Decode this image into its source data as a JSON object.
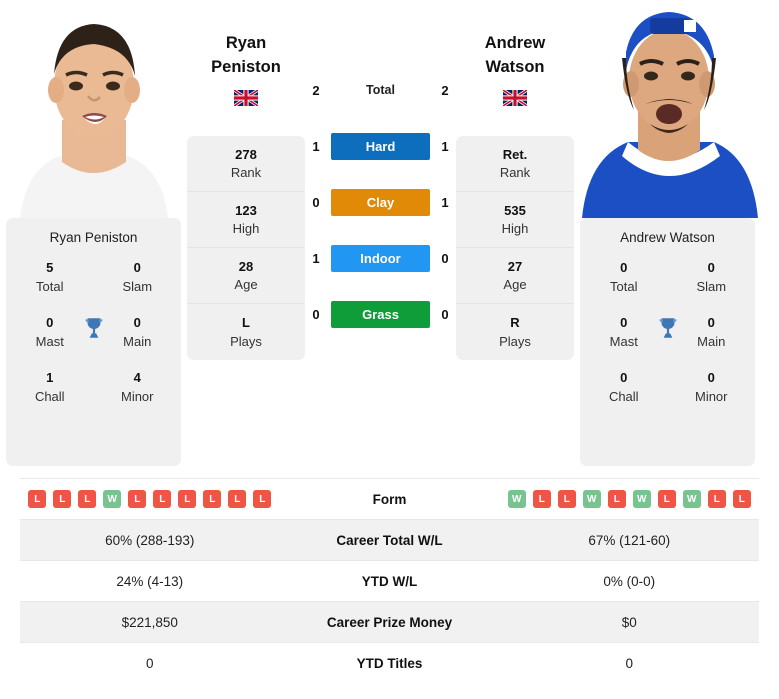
{
  "players": {
    "left": {
      "first_name": "Ryan",
      "last_name": "Peniston",
      "full_name": "Ryan Peniston",
      "flag": "united-kingdom-flag",
      "rank": "278",
      "rank_label": "Rank",
      "high": "123",
      "high_label": "High",
      "age": "28",
      "age_label": "Age",
      "plays": "L",
      "plays_label": "Plays",
      "titles": {
        "total": "5",
        "total_label": "Total",
        "slam": "0",
        "slam_label": "Slam",
        "mast": "0",
        "mast_label": "Mast",
        "main": "0",
        "main_label": "Main",
        "chall": "1",
        "chall_label": "Chall",
        "minor": "4",
        "minor_label": "Minor"
      },
      "form": [
        "L",
        "L",
        "L",
        "W",
        "L",
        "L",
        "L",
        "L",
        "L",
        "L"
      ],
      "career_total_wl": "60% (288-193)",
      "ytd_wl": "24% (4-13)",
      "career_prize_money": "$221,850",
      "ytd_titles": "0"
    },
    "right": {
      "first_name": "Andrew",
      "last_name": "Watson",
      "full_name": "Andrew Watson",
      "flag": "united-kingdom-flag",
      "rank": "Ret.",
      "rank_label": "Rank",
      "high": "535",
      "high_label": "High",
      "age": "27",
      "age_label": "Age",
      "plays": "R",
      "plays_label": "Plays",
      "titles": {
        "total": "0",
        "total_label": "Total",
        "slam": "0",
        "slam_label": "Slam",
        "mast": "0",
        "mast_label": "Mast",
        "main": "0",
        "main_label": "Main",
        "chall": "0",
        "chall_label": "Chall",
        "minor": "0",
        "minor_label": "Minor"
      },
      "form": [
        "W",
        "L",
        "L",
        "W",
        "L",
        "W",
        "L",
        "W",
        "L",
        "L"
      ],
      "career_total_wl": "67% (121-60)",
      "ytd_wl": "0% (0-0)",
      "career_prize_money": "$0",
      "ytd_titles": "0"
    }
  },
  "head_to_head": {
    "total": {
      "label": "Total",
      "left": "2",
      "right": "2"
    },
    "surfaces": [
      {
        "label": "Hard",
        "left": "1",
        "right": "1",
        "color": "#0d6ebd"
      },
      {
        "label": "Clay",
        "left": "0",
        "right": "1",
        "color": "#e18a07"
      },
      {
        "label": "Indoor",
        "left": "1",
        "right": "0",
        "color": "#2196f3"
      },
      {
        "label": "Grass",
        "left": "0",
        "right": "0",
        "color": "#0f9d3a"
      }
    ]
  },
  "table": {
    "form_label": "Form",
    "rows": [
      {
        "label": "Career Total W/L",
        "left": "60% (288-193)",
        "right": "67% (121-60)"
      },
      {
        "label": "YTD W/L",
        "left": "24% (4-13)",
        "right": "0% (0-0)"
      },
      {
        "label": "Career Prize Money",
        "left": "$221,850",
        "right": "$0"
      },
      {
        "label": "YTD Titles",
        "left": "0",
        "right": "0"
      }
    ]
  },
  "icons": {
    "trophy": "trophy-icon",
    "flag": "uk-flag-icon"
  },
  "colors": {
    "win": "#77c490",
    "loss": "#ef5544",
    "card_bg": "#f0f0f0",
    "row_alt": "#f1f1f1"
  }
}
